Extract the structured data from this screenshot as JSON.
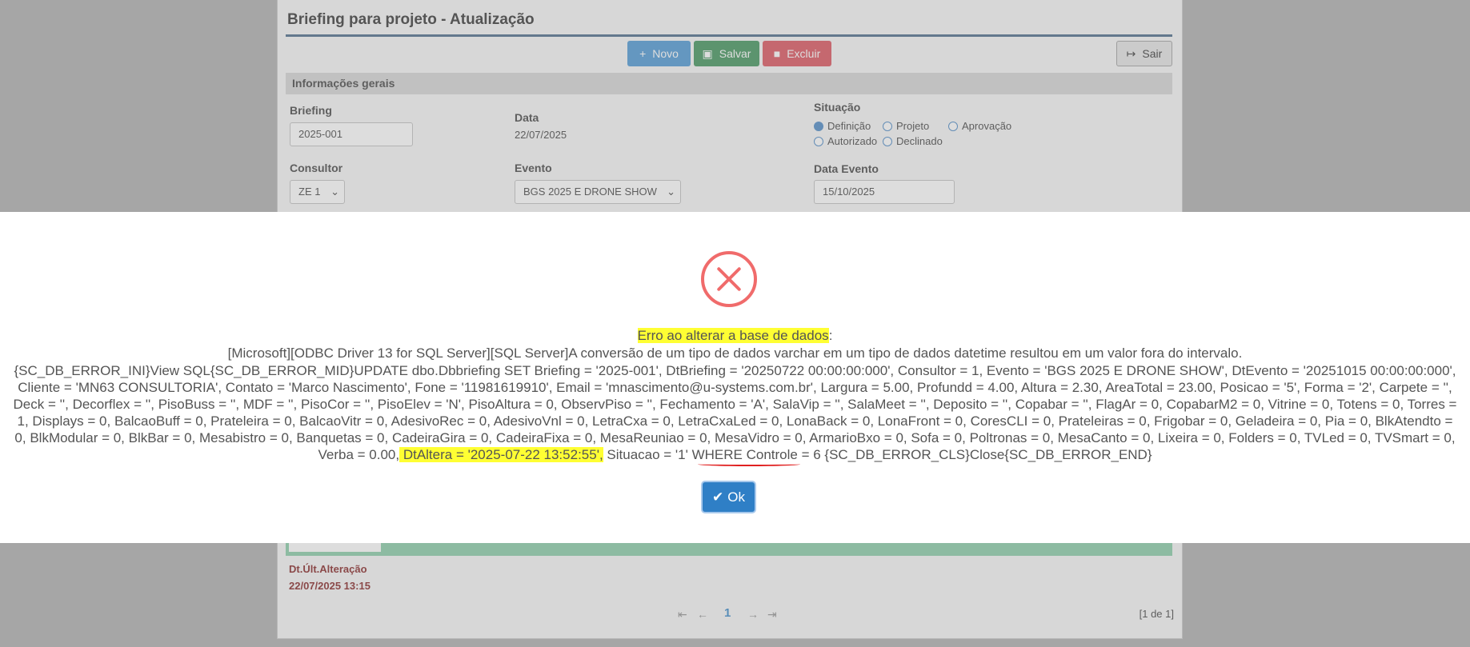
{
  "form": {
    "title": "Briefing para projeto - Atualização",
    "toolbar": {
      "novo": "Novo",
      "salvar": "Salvar",
      "excluir": "Excluir",
      "sair": "Sair"
    },
    "section": "Informações gerais",
    "briefing": {
      "label": "Briefing",
      "value": "2025-001"
    },
    "data": {
      "label": "Data",
      "value": "22/07/2025"
    },
    "situacao": {
      "label": "Situação",
      "options": [
        "Definição",
        "Projeto",
        "Aprovação",
        "Autorizado",
        "Declinado"
      ],
      "selected": "Definição"
    },
    "consultor": {
      "label": "Consultor",
      "value": "ZE 1"
    },
    "evento": {
      "label": "Evento",
      "value": "BGS 2025 E DRONE SHOW"
    },
    "data_evento": {
      "label": "Data Evento",
      "value": "15/10/2025"
    },
    "dt_alteracao": {
      "label": "Dt.Últ.Alteração",
      "value": "22/07/2025 13:15"
    },
    "pager": {
      "current": "1",
      "info": "[1 de 1]"
    }
  },
  "modal": {
    "heading": "Erro ao alterar a base de dados",
    "heading_suffix": ":",
    "odbc_line": "[Microsoft][ODBC Driver 13 for SQL Server][SQL Server]A conversão de um tipo de dados varchar em um tipo de dados datetime resultou em um valor fora do intervalo.",
    "sql_before": "{SC_DB_ERROR_INI}View SQL{SC_DB_ERROR_MID}UPDATE dbo.Dbbriefing SET Briefing = '2025-001', DtBriefing = '20250722 00:00:00:000', Consultor = 1, Evento = 'BGS 2025 E DRONE SHOW', DtEvento = '20251015 00:00:00:000', Cliente = 'MN63 CONSULTORIA', Contato = 'Marco Nascimento', Fone = '11981619910', Email = 'mnascimento@u-systems.com.br', Largura = 5.00, Profundd = 4.00, Altura = 2.30, AreaTotal = 23.00, Posicao = '5', Forma = '2', Carpete = '', Deck = '', Decorflex = '', PisoBuss = '', MDF = '', PisoCor = '', PisoElev = 'N', PisoAltura = 0, ObservPiso = '', Fechamento = 'A', SalaVip = '', SalaMeet = '', Deposito = '', Copabar = '', FlagAr = 0, CopabarM2 = 0, Vitrine = 0, Totens = 0, Torres = 1, Displays = 0, BalcaoBuff = 0, Prateleira = 0, BalcaoVitr = 0, AdesivoRec = 0, AdesivoVnl = 0, LetraCxa = 0, LetraCxaLed = 0, LonaBack = 0, LonaFront = 0, CoresCLI = 0, Prateleiras = 0, Frigobar = 0, Geladeira = 0, Pia = 0, BlkAtendto = 0, BlkModular = 0, BlkBar = 0, Mesabistro = 0, Banquetas = 0, CadeiraGira = 0, CadeiraFixa = 0, MesaReuniao = 0, MesaVidro = 0, ArmarioBxo = 0, Sofa = 0, Poltronas = 0, MesaCanto = 0, Lixeira = 0, Folders = 0, TVLed = 0, TVSmart = 0, Verba = 0.00,",
    "sql_highlight": " DtAltera = '2025-07-22 13:52:55',",
    "sql_after": " Situacao = '1' WHERE Controle = 6 {SC_DB_ERROR_CLS}Close{SC_DB_ERROR_END}",
    "ok_label": "Ok",
    "highlight_color": "#ffff33",
    "ok_color": "#2f7fc6"
  }
}
